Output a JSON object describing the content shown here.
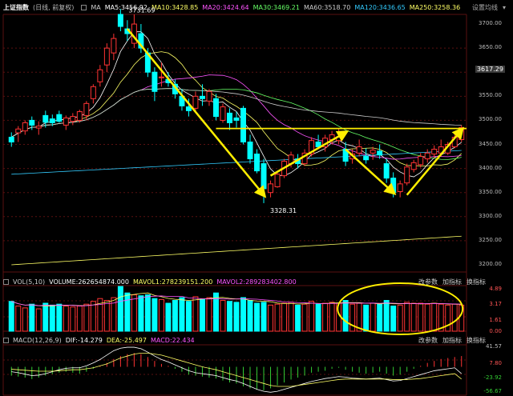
{
  "main_header": {
    "title": "上证指数",
    "subtitle": "(日线, 前复权)",
    "indicators": [
      {
        "label": "MA",
        "color": "#cccccc"
      },
      {
        "label": "MA5:3456.92",
        "color": "#ffffff"
      },
      {
        "label": "MA10:3428.85",
        "color": "#ffff66"
      },
      {
        "label": "MA20:3424.64",
        "color": "#ff55ff"
      },
      {
        "label": "MA30:3469.21",
        "color": "#66ff66"
      },
      {
        "label": "MA60:3518.70",
        "color": "#cccccc"
      },
      {
        "label": "MA120:3436.65",
        "color": "#33ccff"
      },
      {
        "label": "MA250:3258.36",
        "color": "#ffff66"
      }
    ],
    "settings_link": "设置均线"
  },
  "main_axis": [
    "3700.00",
    "3650.00",
    "3600.00",
    "3550.00",
    "3500.00",
    "3450.00",
    "3400.00",
    "3350.00",
    "3300.00",
    "3250.00",
    "3200.00"
  ],
  "current_price": "3617.29",
  "annotations": {
    "high": "3731.69",
    "low": "3328.31"
  },
  "vol_header": {
    "indicators": [
      {
        "label": "VOL(5,10)",
        "color": "#cccccc"
      },
      {
        "label": "VOLUME:262654874.000",
        "color": "#ffffff"
      },
      {
        "label": "MAVOL1:278239151.200",
        "color": "#ffff66"
      },
      {
        "label": "MAVOL2:289283402.800",
        "color": "#ff55ff"
      }
    ],
    "buttons": [
      "改参数",
      "加指标",
      "换指标"
    ]
  },
  "vol_axis": [
    {
      "v": "4.89",
      "c": "#ff5555"
    },
    {
      "v": "3.17",
      "c": "#ff5555"
    },
    {
      "v": "1.61",
      "c": "#ff5555"
    },
    {
      "v": "0.00",
      "c": "#ff5555"
    }
  ],
  "macd_header": {
    "indicators": [
      {
        "label": "MACD(12,26,9)",
        "color": "#cccccc"
      },
      {
        "label": "DIF:-14.279",
        "color": "#ffffff"
      },
      {
        "label": "DEA:-25.497",
        "color": "#ffff66"
      },
      {
        "label": "MACD:22.434",
        "color": "#ff55ff"
      }
    ],
    "buttons": [
      "改参数",
      "加指标",
      "换指标"
    ]
  },
  "macd_axis": [
    {
      "v": "41.57",
      "c": "#bbbbbb"
    },
    {
      "v": "7.80",
      "c": "#ff5555"
    },
    {
      "v": "-23.92",
      "c": "#33cc33"
    },
    {
      "v": "-56.67",
      "c": "#33cc33"
    }
  ],
  "colors": {
    "up": "#ff3333",
    "down": "#00ffff",
    "grid": "#5a1010",
    "arrow": "#ffee00",
    "circle": "#ffee00"
  },
  "chart_data": {
    "type": "candlestick",
    "candles": [
      {
        "o": 3455,
        "h": 3475,
        "l": 3445,
        "c": 3465,
        "up": false
      },
      {
        "o": 3474,
        "h": 3488,
        "l": 3455,
        "c": 3482,
        "up": true
      },
      {
        "o": 3478,
        "h": 3500,
        "l": 3470,
        "c": 3495,
        "up": true
      },
      {
        "o": 3490,
        "h": 3508,
        "l": 3480,
        "c": 3500,
        "up": false
      },
      {
        "o": 3484,
        "h": 3498,
        "l": 3470,
        "c": 3488,
        "up": true
      },
      {
        "o": 3496,
        "h": 3520,
        "l": 3485,
        "c": 3510,
        "up": false
      },
      {
        "o": 3503,
        "h": 3512,
        "l": 3488,
        "c": 3495,
        "up": false
      },
      {
        "o": 3498,
        "h": 3520,
        "l": 3495,
        "c": 3512,
        "up": false
      },
      {
        "o": 3490,
        "h": 3510,
        "l": 3480,
        "c": 3505,
        "up": true
      },
      {
        "o": 3498,
        "h": 3515,
        "l": 3490,
        "c": 3508,
        "up": true
      },
      {
        "o": 3500,
        "h": 3522,
        "l": 3495,
        "c": 3518,
        "up": true
      },
      {
        "o": 3510,
        "h": 3540,
        "l": 3500,
        "c": 3535,
        "up": true
      },
      {
        "o": 3545,
        "h": 3575,
        "l": 3535,
        "c": 3570,
        "up": true
      },
      {
        "o": 3580,
        "h": 3615,
        "l": 3570,
        "c": 3605,
        "up": true
      },
      {
        "o": 3615,
        "h": 3660,
        "l": 3600,
        "c": 3650,
        "up": true
      },
      {
        "o": 3640,
        "h": 3680,
        "l": 3625,
        "c": 3670,
        "up": true
      },
      {
        "o": 3695,
        "h": 3731,
        "l": 3685,
        "c": 3720,
        "up": false
      },
      {
        "o": 3690,
        "h": 3708,
        "l": 3665,
        "c": 3680,
        "up": false
      },
      {
        "o": 3660,
        "h": 3720,
        "l": 3650,
        "c": 3700,
        "up": true
      },
      {
        "o": 3680,
        "h": 3700,
        "l": 3640,
        "c": 3650,
        "up": false
      },
      {
        "o": 3640,
        "h": 3650,
        "l": 3590,
        "c": 3600,
        "up": false
      },
      {
        "o": 3600,
        "h": 3610,
        "l": 3540,
        "c": 3560,
        "up": false
      },
      {
        "o": 3590,
        "h": 3620,
        "l": 3570,
        "c": 3590,
        "up": true
      },
      {
        "o": 3585,
        "h": 3600,
        "l": 3570,
        "c": 3578,
        "up": false
      },
      {
        "o": 3575,
        "h": 3585,
        "l": 3545,
        "c": 3555,
        "up": false
      },
      {
        "o": 3550,
        "h": 3565,
        "l": 3520,
        "c": 3530,
        "up": false
      },
      {
        "o": 3528,
        "h": 3545,
        "l": 3508,
        "c": 3520,
        "up": false
      },
      {
        "o": 3525,
        "h": 3560,
        "l": 3515,
        "c": 3550,
        "up": true
      },
      {
        "o": 3550,
        "h": 3575,
        "l": 3530,
        "c": 3545,
        "up": false
      },
      {
        "o": 3540,
        "h": 3565,
        "l": 3530,
        "c": 3560,
        "up": true
      },
      {
        "o": 3545,
        "h": 3555,
        "l": 3500,
        "c": 3508,
        "up": false
      },
      {
        "o": 3500,
        "h": 3535,
        "l": 3495,
        "c": 3528,
        "up": true
      },
      {
        "o": 3515,
        "h": 3525,
        "l": 3480,
        "c": 3495,
        "up": false
      },
      {
        "o": 3505,
        "h": 3518,
        "l": 3485,
        "c": 3500,
        "up": false
      },
      {
        "o": 3525,
        "h": 3530,
        "l": 3450,
        "c": 3455,
        "up": false
      },
      {
        "o": 3455,
        "h": 3470,
        "l": 3410,
        "c": 3420,
        "up": false
      },
      {
        "o": 3430,
        "h": 3440,
        "l": 3390,
        "c": 3395,
        "up": false
      },
      {
        "o": 3410,
        "h": 3420,
        "l": 3328,
        "c": 3358,
        "up": false
      },
      {
        "o": 3350,
        "h": 3375,
        "l": 3340,
        "c": 3368,
        "up": true
      },
      {
        "o": 3362,
        "h": 3395,
        "l": 3360,
        "c": 3388,
        "up": true
      },
      {
        "o": 3385,
        "h": 3420,
        "l": 3380,
        "c": 3415,
        "up": true
      },
      {
        "o": 3410,
        "h": 3435,
        "l": 3402,
        "c": 3428,
        "up": true
      },
      {
        "o": 3420,
        "h": 3430,
        "l": 3400,
        "c": 3410,
        "up": false
      },
      {
        "o": 3410,
        "h": 3440,
        "l": 3405,
        "c": 3432,
        "up": true
      },
      {
        "o": 3430,
        "h": 3465,
        "l": 3425,
        "c": 3458,
        "up": true
      },
      {
        "o": 3455,
        "h": 3470,
        "l": 3440,
        "c": 3445,
        "up": false
      },
      {
        "o": 3445,
        "h": 3470,
        "l": 3435,
        "c": 3463,
        "up": true
      },
      {
        "o": 3460,
        "h": 3478,
        "l": 3450,
        "c": 3470,
        "up": true
      },
      {
        "o": 3465,
        "h": 3482,
        "l": 3450,
        "c": 3458,
        "up": true
      },
      {
        "o": 3440,
        "h": 3455,
        "l": 3405,
        "c": 3415,
        "up": false
      },
      {
        "o": 3420,
        "h": 3440,
        "l": 3410,
        "c": 3430,
        "up": true
      },
      {
        "o": 3445,
        "h": 3460,
        "l": 3425,
        "c": 3432,
        "up": true
      },
      {
        "o": 3425,
        "h": 3442,
        "l": 3410,
        "c": 3418,
        "up": false
      },
      {
        "o": 3432,
        "h": 3445,
        "l": 3418,
        "c": 3438,
        "up": true
      },
      {
        "o": 3436,
        "h": 3450,
        "l": 3420,
        "c": 3428,
        "up": false
      },
      {
        "o": 3410,
        "h": 3420,
        "l": 3370,
        "c": 3380,
        "up": false
      },
      {
        "o": 3380,
        "h": 3392,
        "l": 3340,
        "c": 3350,
        "up": false
      },
      {
        "o": 3352,
        "h": 3375,
        "l": 3340,
        "c": 3368,
        "up": true
      },
      {
        "o": 3370,
        "h": 3410,
        "l": 3365,
        "c": 3403,
        "up": true
      },
      {
        "o": 3398,
        "h": 3418,
        "l": 3392,
        "c": 3412,
        "up": true
      },
      {
        "o": 3408,
        "h": 3432,
        "l": 3402,
        "c": 3425,
        "up": true
      },
      {
        "o": 3420,
        "h": 3440,
        "l": 3412,
        "c": 3432,
        "up": true
      },
      {
        "o": 3430,
        "h": 3448,
        "l": 3422,
        "c": 3440,
        "up": true
      },
      {
        "o": 3445,
        "h": 3460,
        "l": 3425,
        "c": 3432,
        "up": true
      },
      {
        "o": 3432,
        "h": 3455,
        "l": 3428,
        "c": 3450,
        "up": true
      },
      {
        "o": 3445,
        "h": 3470,
        "l": 3442,
        "c": 3465,
        "up": true
      },
      {
        "o": 3460,
        "h": 3490,
        "l": 3455,
        "c": 3485,
        "up": true
      }
    ],
    "volume": [
      {
        "v": 3.2,
        "up": false
      },
      {
        "v": 2.7,
        "up": true
      },
      {
        "v": 2.5,
        "up": true
      },
      {
        "v": 2.9,
        "up": false
      },
      {
        "v": 2.4,
        "up": true
      },
      {
        "v": 3.0,
        "up": false
      },
      {
        "v": 2.8,
        "up": false
      },
      {
        "v": 2.9,
        "up": false
      },
      {
        "v": 2.7,
        "up": true
      },
      {
        "v": 2.6,
        "up": true
      },
      {
        "v": 2.7,
        "up": true
      },
      {
        "v": 2.9,
        "up": true
      },
      {
        "v": 3.2,
        "up": true
      },
      {
        "v": 3.5,
        "up": true
      },
      {
        "v": 3.3,
        "up": true
      },
      {
        "v": 3.6,
        "up": true
      },
      {
        "v": 4.8,
        "up": false
      },
      {
        "v": 4.1,
        "up": false
      },
      {
        "v": 3.9,
        "up": true
      },
      {
        "v": 3.8,
        "up": false
      },
      {
        "v": 3.9,
        "up": false
      },
      {
        "v": 3.5,
        "up": false
      },
      {
        "v": 3.4,
        "up": true
      },
      {
        "v": 3.0,
        "up": false
      },
      {
        "v": 3.3,
        "up": false
      },
      {
        "v": 3.6,
        "up": false
      },
      {
        "v": 3.2,
        "up": false
      },
      {
        "v": 3.7,
        "up": true
      },
      {
        "v": 3.4,
        "up": false
      },
      {
        "v": 3.6,
        "up": true
      },
      {
        "v": 4.1,
        "up": false
      },
      {
        "v": 3.3,
        "up": true
      },
      {
        "v": 3.2,
        "up": false
      },
      {
        "v": 3.1,
        "up": false
      },
      {
        "v": 3.6,
        "up": false
      },
      {
        "v": 3.3,
        "up": false
      },
      {
        "v": 3.0,
        "up": false
      },
      {
        "v": 3.1,
        "up": false
      },
      {
        "v": 2.8,
        "up": true
      },
      {
        "v": 2.9,
        "up": true
      },
      {
        "v": 3.0,
        "up": true
      },
      {
        "v": 3.1,
        "up": true
      },
      {
        "v": 2.8,
        "up": false
      },
      {
        "v": 2.9,
        "up": true
      },
      {
        "v": 3.2,
        "up": true
      },
      {
        "v": 2.9,
        "up": false
      },
      {
        "v": 3.0,
        "up": true
      },
      {
        "v": 3.1,
        "up": true
      },
      {
        "v": 3.0,
        "up": true
      },
      {
        "v": 3.3,
        "up": false
      },
      {
        "v": 2.9,
        "up": true
      },
      {
        "v": 3.0,
        "up": true
      },
      {
        "v": 2.8,
        "up": false
      },
      {
        "v": 3.0,
        "up": true
      },
      {
        "v": 2.9,
        "up": false
      },
      {
        "v": 3.3,
        "up": false
      },
      {
        "v": 2.7,
        "up": false
      },
      {
        "v": 2.8,
        "up": true
      },
      {
        "v": 3.1,
        "up": true
      },
      {
        "v": 3.0,
        "up": true
      },
      {
        "v": 3.0,
        "up": true
      },
      {
        "v": 2.9,
        "up": true
      },
      {
        "v": 3.0,
        "up": true
      },
      {
        "v": 2.9,
        "up": true
      },
      {
        "v": 2.8,
        "up": true
      },
      {
        "v": 2.9,
        "up": true
      },
      {
        "v": 2.8,
        "up": true
      }
    ],
    "macd_hist": [
      -18,
      -20,
      -22,
      -25,
      -22,
      -18,
      -15,
      -12,
      -10,
      -12,
      -14,
      -10,
      -4,
      2,
      8,
      16,
      22,
      26,
      28,
      26,
      20,
      12,
      6,
      2,
      -4,
      -10,
      -16,
      -18,
      -20,
      -22,
      -24,
      -28,
      -32,
      -34,
      -40,
      -44,
      -46,
      -48,
      -44,
      -38,
      -32,
      -26,
      -22,
      -18,
      -12,
      -10,
      -8,
      -4,
      -2,
      -6,
      -10,
      -12,
      -14,
      -12,
      -10,
      -14,
      -18,
      -16,
      -10,
      -4,
      2,
      8,
      12,
      16,
      18,
      20,
      22
    ],
    "dif": [
      -10,
      -12,
      -15,
      -18,
      -17,
      -14,
      -10,
      -6,
      -3,
      -2,
      -2,
      2,
      8,
      15,
      24,
      33,
      38,
      40,
      40,
      37,
      30,
      22,
      15,
      10,
      4,
      -2,
      -8,
      -12,
      -14,
      -16,
      -18,
      -22,
      -26,
      -29,
      -34,
      -40,
      -46,
      -50,
      -52,
      -50,
      -46,
      -42,
      -38,
      -34,
      -30,
      -27,
      -24,
      -22,
      -20,
      -21,
      -23,
      -24,
      -25,
      -24,
      -23,
      -26,
      -29,
      -28,
      -24,
      -20,
      -16,
      -12,
      -8,
      -6,
      -4,
      -2,
      -14
    ],
    "dea": [
      -5,
      -6,
      -7,
      -8,
      -9,
      -9,
      -9,
      -8,
      -7,
      -6,
      -6,
      -4,
      -2,
      2,
      6,
      12,
      18,
      22,
      26,
      28,
      28,
      26,
      24,
      20,
      16,
      12,
      8,
      4,
      0,
      -3,
      -6,
      -10,
      -14,
      -18,
      -22,
      -26,
      -30,
      -34,
      -38,
      -40,
      -40,
      -40,
      -38,
      -36,
      -34,
      -32,
      -30,
      -28,
      -26,
      -25,
      -25,
      -25,
      -25,
      -25,
      -25,
      -25,
      -26,
      -26,
      -26,
      -25,
      -24,
      -22,
      -20,
      -18,
      -16,
      -14,
      -25
    ]
  }
}
